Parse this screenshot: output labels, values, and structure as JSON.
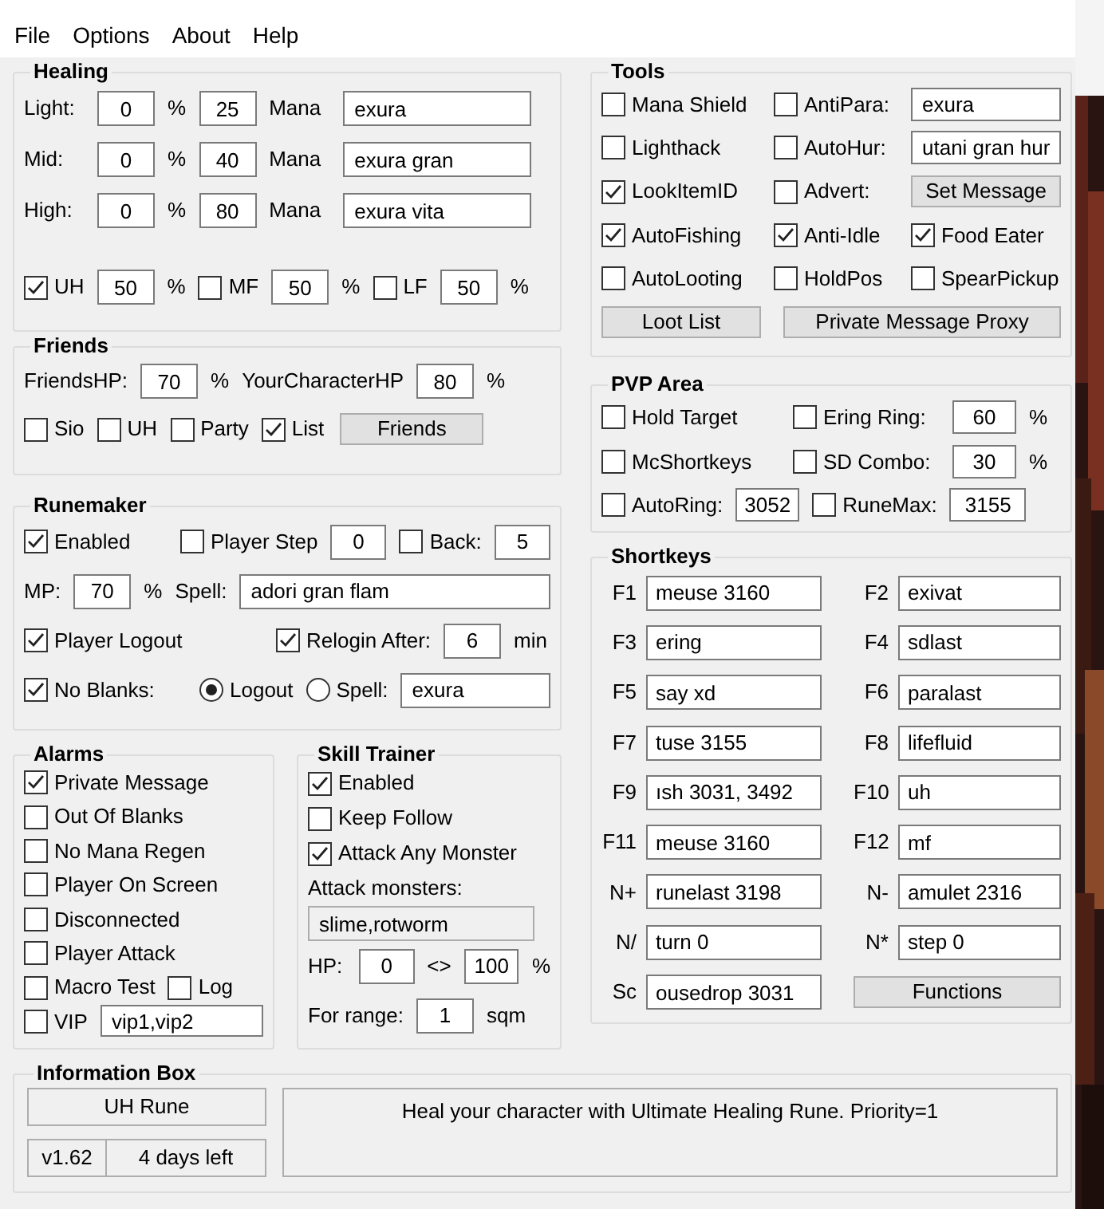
{
  "menu": [
    {
      "label": "File"
    },
    {
      "label": "Options"
    },
    {
      "label": "About"
    },
    {
      "label": "Help"
    }
  ],
  "left": [
    {
      "title": "Healing",
      "rows": [
        {
          "controls": [
            {
              "kind": "label",
              "text": "Light:"
            },
            {
              "kind": "num",
              "value": "0"
            },
            {
              "kind": "label",
              "text": "%"
            },
            {
              "kind": "num",
              "value": "25"
            },
            {
              "kind": "label",
              "text": "Mana"
            },
            {
              "kind": "text",
              "value": "exura"
            }
          ]
        },
        {
          "controls": [
            {
              "kind": "label",
              "text": "Mid:"
            },
            {
              "kind": "num",
              "value": "0"
            },
            {
              "kind": "label",
              "text": "%"
            },
            {
              "kind": "num",
              "value": "40"
            },
            {
              "kind": "label",
              "text": "Mana"
            },
            {
              "kind": "text",
              "value": "exura gran"
            }
          ]
        },
        {
          "controls": [
            {
              "kind": "label",
              "text": "High:"
            },
            {
              "kind": "num",
              "value": "0"
            },
            {
              "kind": "label",
              "text": "%"
            },
            {
              "kind": "num",
              "value": "80"
            },
            {
              "kind": "label",
              "text": "Mana"
            },
            {
              "kind": "text",
              "value": "exura vita"
            }
          ]
        },
        {
          "controls": [
            {
              "kind": "check",
              "label": "UH",
              "checked": true
            },
            {
              "kind": "num",
              "value": "50"
            },
            {
              "kind": "label",
              "text": "%"
            },
            {
              "kind": "check",
              "label": "MF",
              "checked": false
            },
            {
              "kind": "num",
              "value": "50"
            },
            {
              "kind": "label",
              "text": "%"
            },
            {
              "kind": "check",
              "label": "LF",
              "checked": false
            },
            {
              "kind": "num",
              "value": "50"
            },
            {
              "kind": "label",
              "text": "%"
            }
          ]
        }
      ]
    },
    {
      "title": "Friends",
      "rows": [
        {
          "controls": [
            {
              "kind": "label",
              "text": "FriendsHP:"
            },
            {
              "kind": "num",
              "value": "70"
            },
            {
              "kind": "label",
              "text": "%"
            },
            {
              "kind": "label",
              "text": "YourCharacterHP"
            },
            {
              "kind": "num",
              "value": "80"
            },
            {
              "kind": "label",
              "text": "%"
            }
          ]
        },
        {
          "controls": [
            {
              "kind": "check",
              "label": "Sio",
              "checked": false
            },
            {
              "kind": "check",
              "label": "UH",
              "checked": false
            },
            {
              "kind": "check",
              "label": "Party",
              "checked": false
            },
            {
              "kind": "check",
              "label": "List",
              "checked": true
            },
            {
              "kind": "button",
              "label": "Friends"
            }
          ]
        }
      ]
    },
    {
      "title": "Runemaker",
      "rows": [
        {
          "controls": [
            {
              "kind": "check",
              "label": "Enabled",
              "checked": true
            },
            {
              "kind": "check",
              "label": "Player Step",
              "checked": false
            },
            {
              "kind": "num",
              "value": "0"
            },
            {
              "kind": "check",
              "label": "Back:",
              "checked": false
            },
            {
              "kind": "num",
              "value": "5"
            }
          ]
        },
        {
          "controls": [
            {
              "kind": "label",
              "text": "MP:"
            },
            {
              "kind": "num",
              "value": "70"
            },
            {
              "kind": "label",
              "text": "%"
            },
            {
              "kind": "label",
              "text": "Spell:"
            },
            {
              "kind": "text",
              "value": "adori gran flam"
            }
          ]
        },
        {
          "controls": [
            {
              "kind": "check",
              "label": "Player Logout",
              "checked": true
            },
            {
              "kind": "check",
              "label": "Relogin After:",
              "checked": true
            },
            {
              "kind": "num",
              "value": "6"
            },
            {
              "kind": "label",
              "text": "min"
            }
          ]
        },
        {
          "controls": [
            {
              "kind": "check",
              "label": "No Blanks:",
              "checked": true
            },
            {
              "kind": "radio",
              "label": "Logout",
              "selected": true
            },
            {
              "kind": "radio",
              "label": "Spell:",
              "selected": false
            },
            {
              "kind": "text",
              "value": "exura"
            }
          ]
        }
      ]
    }
  ],
  "alarms": {
    "title": "Alarms",
    "rows": [
      {
        "controls": [
          {
            "kind": "check",
            "label": "Private Message",
            "checked": true
          }
        ]
      },
      {
        "controls": [
          {
            "kind": "check",
            "label": "Out Of Blanks",
            "checked": false
          }
        ]
      },
      {
        "controls": [
          {
            "kind": "check",
            "label": "No Mana Regen",
            "checked": false
          }
        ]
      },
      {
        "controls": [
          {
            "kind": "check",
            "label": "Player On Screen",
            "checked": false
          }
        ]
      },
      {
        "controls": [
          {
            "kind": "check",
            "label": "Disconnected",
            "checked": false
          }
        ]
      },
      {
        "controls": [
          {
            "kind": "check",
            "label": "Player Attack",
            "checked": false
          }
        ]
      },
      {
        "controls": [
          {
            "kind": "check",
            "label": "Macro Test",
            "checked": false
          },
          {
            "kind": "check",
            "label": "Log",
            "checked": false
          }
        ]
      },
      {
        "controls": [
          {
            "kind": "check",
            "label": "VIP",
            "checked": false
          },
          {
            "kind": "text",
            "value": "vip1,vip2"
          }
        ]
      }
    ]
  },
  "skill_trainer": {
    "title": "Skill Trainer",
    "rows": [
      {
        "controls": [
          {
            "kind": "check",
            "label": "Enabled",
            "checked": true
          }
        ]
      },
      {
        "controls": [
          {
            "kind": "check",
            "label": "Keep Follow",
            "checked": false
          }
        ]
      },
      {
        "controls": [
          {
            "kind": "check",
            "label": "Attack Any Monster",
            "checked": true
          }
        ]
      },
      {
        "controls": [
          {
            "kind": "label",
            "text": "Attack monsters:"
          }
        ]
      },
      {
        "controls": [
          {
            "kind": "text",
            "value": "slime,rotworm",
            "disabled": true
          }
        ]
      },
      {
        "controls": [
          {
            "kind": "label",
            "text": "HP:"
          },
          {
            "kind": "num",
            "value": "0"
          },
          {
            "kind": "label",
            "text": "<>"
          },
          {
            "kind": "num",
            "value": "100"
          },
          {
            "kind": "label",
            "text": "%"
          }
        ]
      },
      {
        "controls": [
          {
            "kind": "label",
            "text": "For range:"
          },
          {
            "kind": "num",
            "value": "1"
          },
          {
            "kind": "label",
            "text": "sqm"
          }
        ]
      }
    ]
  },
  "right": [
    {
      "title": "Tools",
      "rows": [
        {
          "controls": [
            {
              "kind": "check",
              "label": "Mana Shield",
              "checked": false
            },
            {
              "kind": "check",
              "label": "AntiPara:",
              "checked": false
            },
            {
              "kind": "text",
              "value": "exura"
            }
          ]
        },
        {
          "controls": [
            {
              "kind": "check",
              "label": "Lighthack",
              "checked": false
            },
            {
              "kind": "check",
              "label": "AutoHur:",
              "checked": false
            },
            {
              "kind": "text",
              "value": "utani gran hur"
            }
          ]
        },
        {
          "controls": [
            {
              "kind": "check",
              "label": "LookItemID",
              "checked": true
            },
            {
              "kind": "check",
              "label": "Advert:",
              "checked": false
            },
            {
              "kind": "button",
              "label": "Set Message"
            }
          ]
        },
        {
          "controls": [
            {
              "kind": "check",
              "label": "AutoFishing",
              "checked": true
            },
            {
              "kind": "check",
              "label": "Anti-Idle",
              "checked": true
            },
            {
              "kind": "check",
              "label": "Food Eater",
              "checked": true
            }
          ]
        },
        {
          "controls": [
            {
              "kind": "check",
              "label": "AutoLooting",
              "checked": false
            },
            {
              "kind": "check",
              "label": "HoldPos",
              "checked": false
            },
            {
              "kind": "check",
              "label": "SpearPickup",
              "checked": false
            }
          ]
        },
        {
          "controls": [
            {
              "kind": "button",
              "label": "Loot List"
            },
            {
              "kind": "button",
              "label": "Private Message Proxy"
            }
          ]
        }
      ]
    },
    {
      "title": "PVP Area",
      "rows": [
        {
          "controls": [
            {
              "kind": "check",
              "label": "Hold Target",
              "checked": false
            },
            {
              "kind": "check",
              "label": "Ering Ring:",
              "checked": false
            },
            {
              "kind": "num",
              "value": "60"
            },
            {
              "kind": "label",
              "text": "%"
            }
          ]
        },
        {
          "controls": [
            {
              "kind": "check",
              "label": "McShortkeys",
              "checked": false
            },
            {
              "kind": "check",
              "label": "SD Combo:",
              "checked": false
            },
            {
              "kind": "num",
              "value": "30"
            },
            {
              "kind": "label",
              "text": "%"
            }
          ]
        },
        {
          "controls": [
            {
              "kind": "check",
              "label": "AutoRing:",
              "checked": false
            },
            {
              "kind": "num",
              "value": "3052"
            },
            {
              "kind": "check",
              "label": "RuneMax:",
              "checked": false
            },
            {
              "kind": "num",
              "value": "3155"
            }
          ]
        }
      ]
    },
    {
      "title": "Shortkeys",
      "rows": [
        {
          "controls": [
            {
              "kind": "label",
              "text": "F1"
            },
            {
              "kind": "text",
              "value": "meuse 3160"
            },
            {
              "kind": "label",
              "text": "F2"
            },
            {
              "kind": "text",
              "value": "exivat"
            }
          ]
        },
        {
          "controls": [
            {
              "kind": "label",
              "text": "F3"
            },
            {
              "kind": "text",
              "value": "ering"
            },
            {
              "kind": "label",
              "text": "F4"
            },
            {
              "kind": "text",
              "value": "sdlast"
            }
          ]
        },
        {
          "controls": [
            {
              "kind": "label",
              "text": "F5"
            },
            {
              "kind": "text",
              "value": "say xd"
            },
            {
              "kind": "label",
              "text": "F6"
            },
            {
              "kind": "text",
              "value": "paralast"
            }
          ]
        },
        {
          "controls": [
            {
              "kind": "label",
              "text": "F7"
            },
            {
              "kind": "text",
              "value": "tuse 3155"
            },
            {
              "kind": "label",
              "text": "F8"
            },
            {
              "kind": "text",
              "value": "lifefluid"
            }
          ]
        },
        {
          "controls": [
            {
              "kind": "label",
              "text": "F9"
            },
            {
              "kind": "text",
              "value": "ısh 3031, 3492"
            },
            {
              "kind": "label",
              "text": "F10"
            },
            {
              "kind": "text",
              "value": "uh"
            }
          ]
        },
        {
          "controls": [
            {
              "kind": "label",
              "text": "F11"
            },
            {
              "kind": "text",
              "value": "meuse 3160"
            },
            {
              "kind": "label",
              "text": "F12"
            },
            {
              "kind": "text",
              "value": "mf"
            }
          ]
        },
        {
          "controls": [
            {
              "kind": "label",
              "text": "N+"
            },
            {
              "kind": "text",
              "value": "runelast 3198"
            },
            {
              "kind": "label",
              "text": "N-"
            },
            {
              "kind": "text",
              "value": "amulet 2316"
            }
          ]
        },
        {
          "controls": [
            {
              "kind": "label",
              "text": "N/"
            },
            {
              "kind": "text",
              "value": "turn 0"
            },
            {
              "kind": "label",
              "text": "N*"
            },
            {
              "kind": "text",
              "value": "step 0"
            }
          ]
        },
        {
          "controls": [
            {
              "kind": "label",
              "text": "Sc"
            },
            {
              "kind": "text",
              "value": "ousedrop 3031"
            },
            {
              "kind": "button",
              "label": "Functions"
            }
          ]
        }
      ]
    }
  ],
  "info": {
    "title": "Information Box",
    "item": "UH Rune",
    "version": "v1.62",
    "license": "4 days left",
    "description": "Heal your character with Ultimate Healing Rune. Priority=1"
  }
}
